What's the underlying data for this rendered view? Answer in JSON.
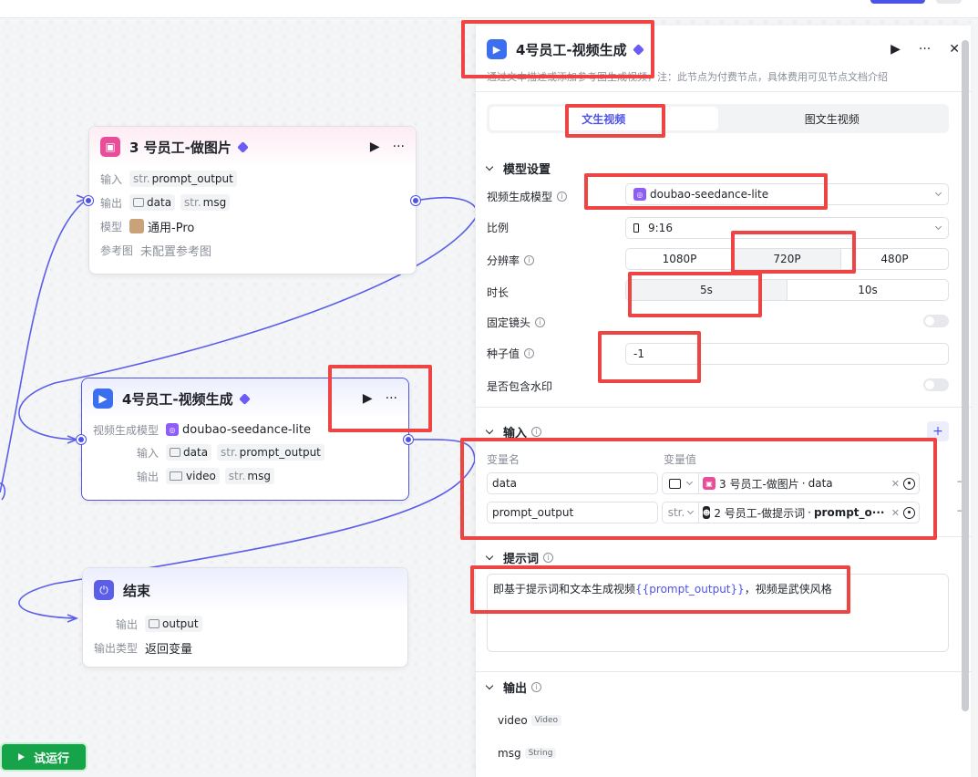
{
  "canvas": {
    "node_image": {
      "title": "3 号员工-做图片",
      "rows": [
        {
          "label": "输入",
          "tags": [
            {
              "pre": "str.",
              "text": "prompt_output"
            }
          ]
        },
        {
          "label": "输出",
          "tags": [
            {
              "pre": "",
              "text": "data"
            },
            {
              "pre": "str.",
              "text": "msg"
            }
          ]
        },
        {
          "label": "模型",
          "value": "通用-Pro"
        },
        {
          "label": "参考图",
          "value": "未配置参考图"
        }
      ]
    },
    "node_video": {
      "title": "4号员工-视频生成",
      "model_label": "视频生成模型",
      "model_value": "doubao-seedance-lite",
      "input_label": "输入",
      "input_tags": [
        {
          "pre": "",
          "text": "data"
        },
        {
          "pre": "str.",
          "text": "prompt_output"
        }
      ],
      "output_label": "输出",
      "output_tags": [
        {
          "pre": "",
          "text": "video"
        },
        {
          "pre": "str.",
          "text": "msg"
        }
      ]
    },
    "node_end": {
      "title": "结束",
      "output_label": "输出",
      "output_tag": "output",
      "type_label": "输出类型",
      "type_value": "返回变量"
    },
    "run_button": "试运行"
  },
  "panel": {
    "title": "4号员工-视频生成",
    "description": "通过文本描述或添加参考图生成视频，注：此节点为付费节点，具体费用可见节点文档介绍",
    "tabs": [
      "文生视频",
      "图文生视频"
    ],
    "active_tab": 0,
    "model_section": {
      "title": "模型设置",
      "model_label": "视频生成模型",
      "model_value": "doubao-seedance-lite",
      "ratio_label": "比例",
      "ratio_value": "9:16",
      "resolution_label": "分辨率",
      "resolution_options": [
        "1080P",
        "720P",
        "480P"
      ],
      "resolution_selected": 1,
      "duration_label": "时长",
      "duration_options": [
        "5s",
        "10s"
      ],
      "duration_selected": 0,
      "fixed_camera_label": "固定镜头",
      "seed_label": "种子值",
      "seed_value": "-1",
      "watermark_label": "是否包含水印"
    },
    "input_section": {
      "title": "输入",
      "col_name": "变量名",
      "col_value": "变量值",
      "rows": [
        {
          "name": "data",
          "type": "",
          "source": "3 号员工-做图片",
          "field": "data"
        },
        {
          "name": "prompt_output",
          "type": "str.",
          "source": "2 号员工-做提示词",
          "field": "prompt_o···"
        }
      ]
    },
    "prompt_section": {
      "title": "提示词",
      "text_before": "即基于提示词和文本生成视频",
      "text_var": "{{prompt_output}}",
      "text_after": "，视频是武侠风格"
    },
    "output_section": {
      "title": "输出",
      "rows": [
        {
          "name": "video",
          "type": "Video"
        },
        {
          "name": "msg",
          "type": "String"
        }
      ]
    }
  },
  "colors": {
    "accent": "#4d53e8",
    "annotation_red": "#ef4444",
    "run_green": "#16a34a",
    "image_node_pink": "#e94d9a",
    "video_node_blue": "#3c6ef0"
  }
}
